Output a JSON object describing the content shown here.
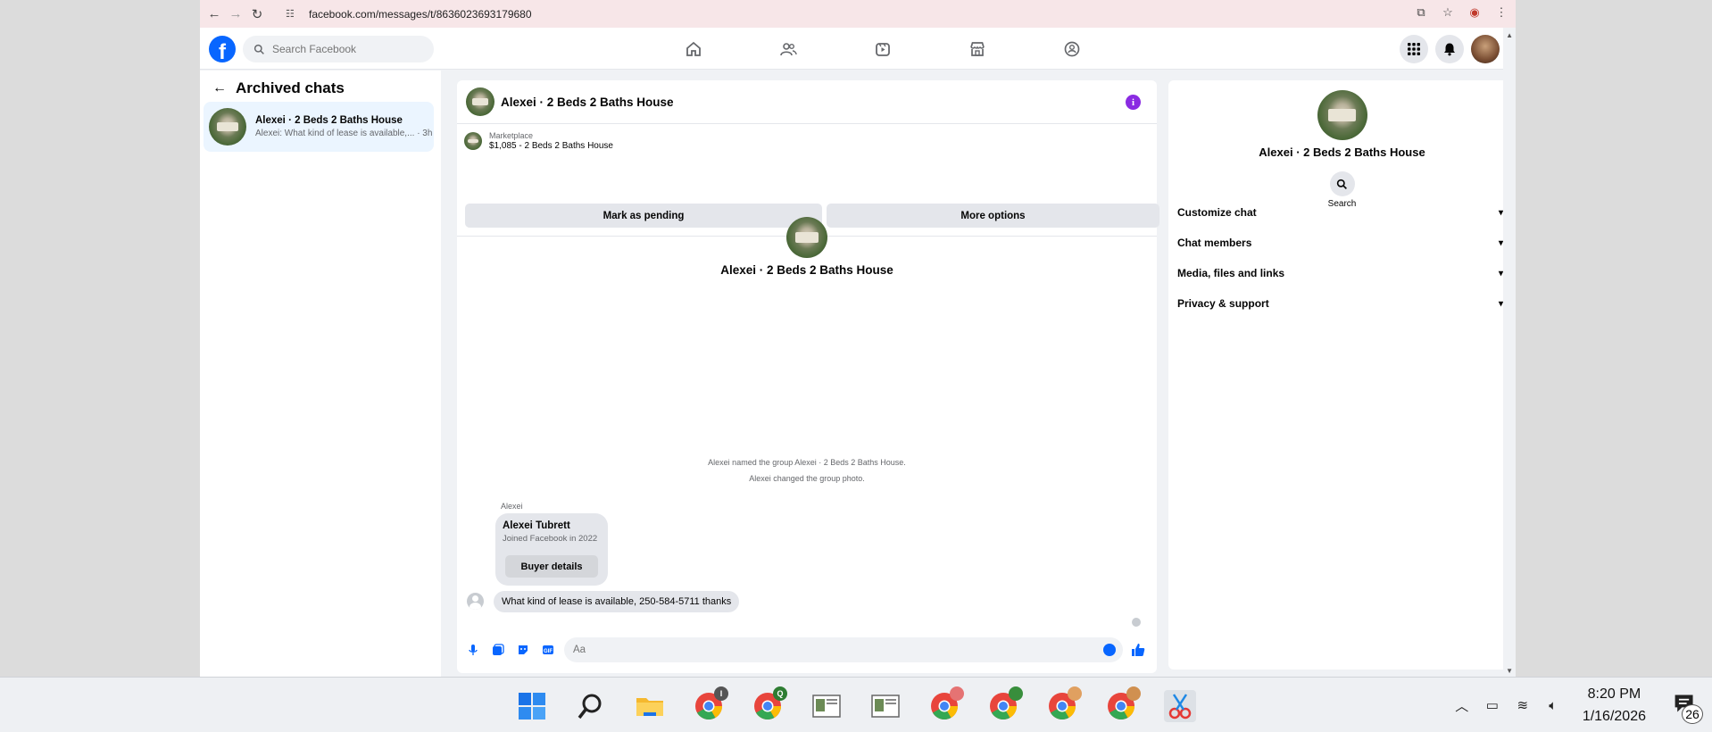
{
  "browser": {
    "url": "facebook.com/messages/t/8636023693179680",
    "back_icon": "←",
    "forward_icon": "→",
    "reload_icon": "↻"
  },
  "fb": {
    "search_placeholder": "Search Facebook",
    "logo_letter": "f",
    "brand_color": "#0866ff"
  },
  "left_panel": {
    "title": "Archived chats",
    "chats": [
      {
        "name": "Alexei · 2 Beds 2 Baths House",
        "preview": "Alexei: What kind of lease is available,... · 3h"
      }
    ]
  },
  "conversation": {
    "title": "Alexei · 2 Beds 2 Baths House",
    "marketplace_label": "Marketplace",
    "listing": "$1,085 - 2 Beds 2 Baths House",
    "mark_pending": "Mark as pending",
    "more_options": "More options",
    "center_title": "Alexei · 2 Beds 2 Baths House",
    "system_messages": [
      "Alexei named the group Alexei · 2 Beds 2 Baths House.",
      "Alexei changed the group photo."
    ],
    "sender": "Alexei",
    "buyer_card": {
      "name": "Alexei Tubrett",
      "sub": "Joined Facebook in 2022",
      "button": "Buyer details"
    },
    "message": "What kind of lease is available, 250-584-5711 thanks",
    "input_placeholder": "Aa"
  },
  "info_panel": {
    "name": "Alexei · 2 Beds 2 Baths House",
    "search_label": "Search",
    "sections": [
      "Customize chat",
      "Chat members",
      "Media, files and links",
      "Privacy & support"
    ]
  },
  "taskbar": {
    "time": "8:20 PM",
    "date": "1/16/2026",
    "notification_count": "26",
    "badges": [
      "I",
      "Q"
    ]
  }
}
